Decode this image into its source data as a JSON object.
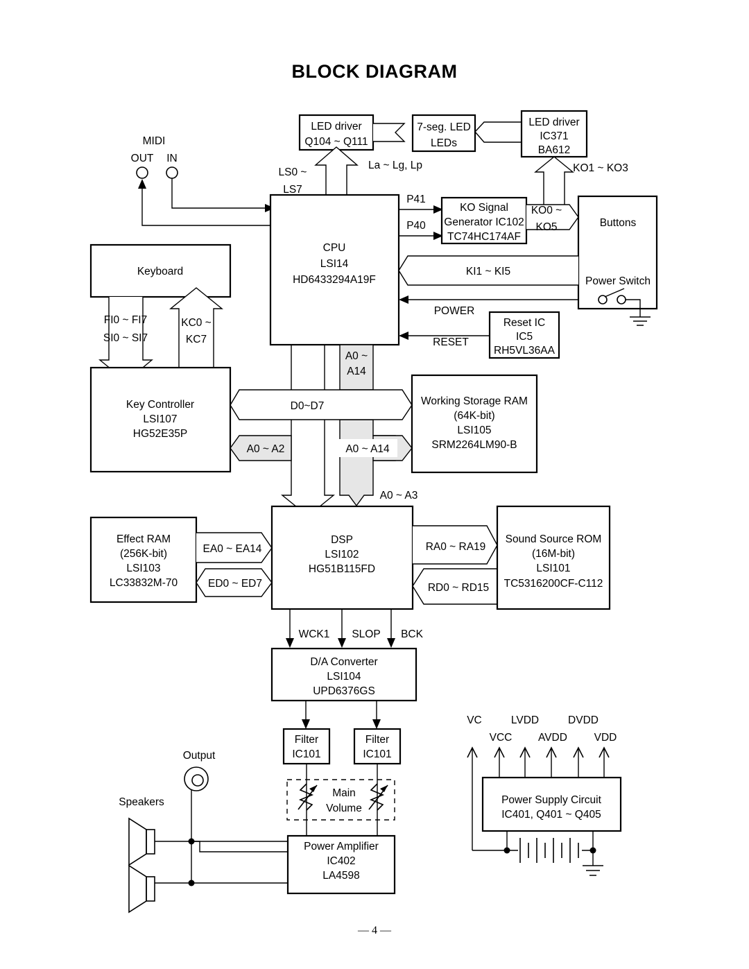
{
  "page": {
    "title": "BLOCK DIAGRAM",
    "page_number": "— 4 —"
  },
  "blocks": {
    "led_driver_left": {
      "l1": "LED driver",
      "l2": "Q104 ~ Q111"
    },
    "seven_seg": {
      "l1": "7-seg. LED",
      "l2": "LEDs"
    },
    "led_driver_right": {
      "l1": "LED driver",
      "l2": "IC371",
      "l3": "BA612"
    },
    "cpu": {
      "l1": "CPU",
      "l2": "LSI14",
      "l3": "HD6433294A19F"
    },
    "ko_gen": {
      "l1": "KO Signal",
      "l2": "Generator IC102",
      "l3": "TC74HC174AF"
    },
    "buttons": {
      "l1": "Buttons",
      "l2": "Power Switch"
    },
    "reset_ic": {
      "l1": "Reset IC",
      "l2": "IC5",
      "l3": "RH5VL36AA"
    },
    "keyboard": {
      "l1": "Keyboard"
    },
    "key_controller": {
      "l1": "Key Controller",
      "l2": "LSI107",
      "l3": "HG52E35P"
    },
    "working_ram": {
      "l1": "Working Storage RAM",
      "l2": "(64K-bit)",
      "l3": "LSI105",
      "l4": "SRM2264LM90-B"
    },
    "effect_ram": {
      "l1": "Effect RAM",
      "l2": "(256K-bit)",
      "l3": "LSI103",
      "l4": "LC33832M-70"
    },
    "dsp": {
      "l1": "DSP",
      "l2": "LSI102",
      "l3": "HG51B115FD"
    },
    "sound_rom": {
      "l1": "Sound Source ROM",
      "l2": "(16M-bit)",
      "l3": "LSI101",
      "l4": "TC5316200CF-C112"
    },
    "dac": {
      "l1": "D/A Converter",
      "l2": "LSI104",
      "l3": "UPD6376GS"
    },
    "filter_left": {
      "l1": "Filter",
      "l2": "IC101"
    },
    "filter_right": {
      "l1": "Filter",
      "l2": "IC101"
    },
    "main_volume": {
      "l1": "Main",
      "l2": "Volume"
    },
    "power_amp": {
      "l1": "Power Amplifier",
      "l2": "IC402",
      "l3": "LA4598"
    },
    "power_supply": {
      "l1": "Power Supply Circuit",
      "l2": "IC401, Q401 ~ Q405"
    }
  },
  "labels": {
    "midi": "MIDI",
    "midi_out": "OUT",
    "midi_in": "IN",
    "ls_bus_1": "LS0 ~",
    "ls_bus_2": "LS7",
    "la_lg_lp": "La ~ Lg, Lp",
    "ko1_ko3": "KO1 ~ KO3",
    "p41": "P41",
    "p40": "P40",
    "ko0_1": "KO0 ~",
    "ko0_2": "KO5",
    "ki1_ki5": "KI1 ~ KI5",
    "power": "POWER",
    "reset": "RESET",
    "fi_bus_1": "FI0 ~ FI7",
    "fi_bus_2": "SI0 ~ SI7",
    "kc_bus_1": "KC0 ~",
    "kc_bus_2": "KC7",
    "a0_a14_top_1": "A0 ~",
    "a0_a14_top_2": "A14",
    "d0_d7": "D0~D7",
    "a0_a2": "A0 ~ A2",
    "a0_a14_mid": "A0 ~ A14",
    "a0_a3": "A0 ~ A3",
    "ea_bus": "EA0 ~ EA14",
    "ed_bus": "ED0 ~ ED7",
    "ra_bus": "RA0 ~ RA19",
    "rd_bus": "RD0 ~ RD15",
    "wck1": "WCK1",
    "slop": "SLOP",
    "bck": "BCK",
    "output": "Output",
    "speakers": "Speakers",
    "vc": "VC",
    "vcc": "VCC",
    "lvdd": "LVDD",
    "avdd": "AVDD",
    "dvdd": "DVDD",
    "vdd": "VDD"
  },
  "colors": {
    "stroke": "#000000",
    "background": "#ffffff",
    "bus_shaded": "#e6e6e6"
  }
}
